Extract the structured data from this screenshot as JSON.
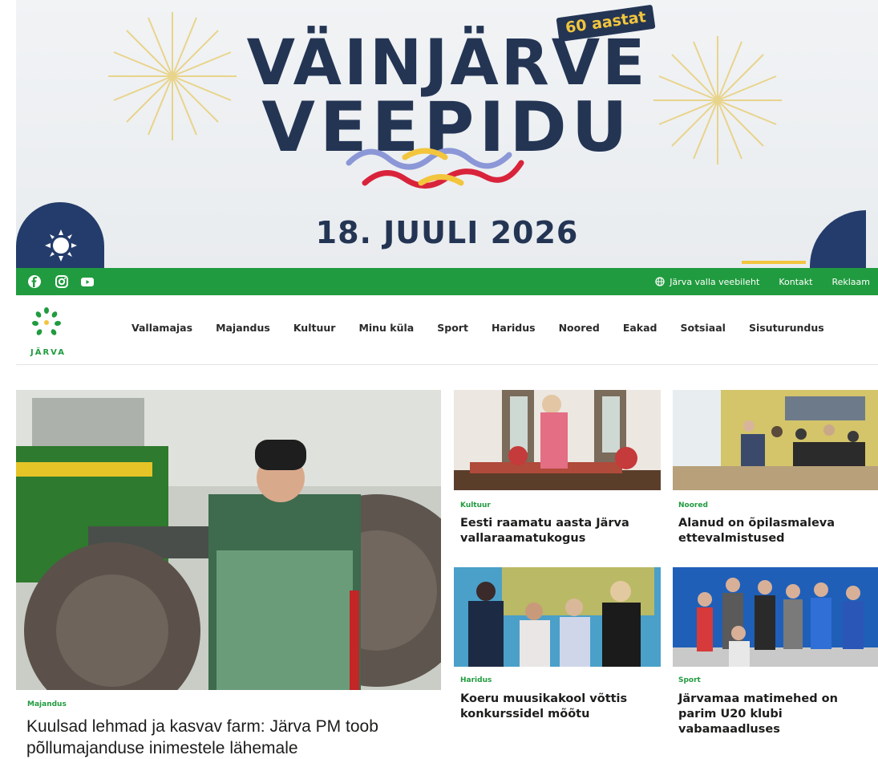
{
  "banner": {
    "title_line1": "VÄINJÄRVE",
    "title_line2": "VEEPIDU",
    "badge": "60 aastat",
    "date": "18. JUULI 2026",
    "colors": {
      "navy": "#243554",
      "yellow": "#f2c53d",
      "red": "#d9233b",
      "blue": "#8b97d6"
    }
  },
  "topbar": {
    "social_icons": [
      "facebook-icon",
      "instagram-icon",
      "youtube-icon"
    ],
    "links": [
      "Järva valla veebileht",
      "Kontakt",
      "Reklaam"
    ],
    "color": "#219b3f"
  },
  "logo": {
    "text": "JÄRVA"
  },
  "nav": {
    "items": [
      "Vallamajas",
      "Majandus",
      "Kultuur",
      "Minu küla",
      "Sport",
      "Haridus",
      "Noored",
      "Eakad",
      "Sotsiaal",
      "Sisuturundus"
    ]
  },
  "articles": {
    "main": {
      "category": "Majandus",
      "title": "Kuulsad lehmad ja kasvav farm: Järva PM toob põllumajanduse inimestele lähemale"
    },
    "a1": {
      "category": "Kultuur",
      "title": "Eesti raamatu aasta Järva vallaraamatukogus"
    },
    "a2": {
      "category": "Noored",
      "title": "Alanud on õpilasmaleva ettevalmistused"
    },
    "a3": {
      "category": "Haridus",
      "title": "Koeru muusikakool võttis konkurssidel mõõtu"
    },
    "a4": {
      "category": "Sport",
      "title": "Järvamaa matimehed on parim U20 klubi vabamaadluses"
    }
  }
}
